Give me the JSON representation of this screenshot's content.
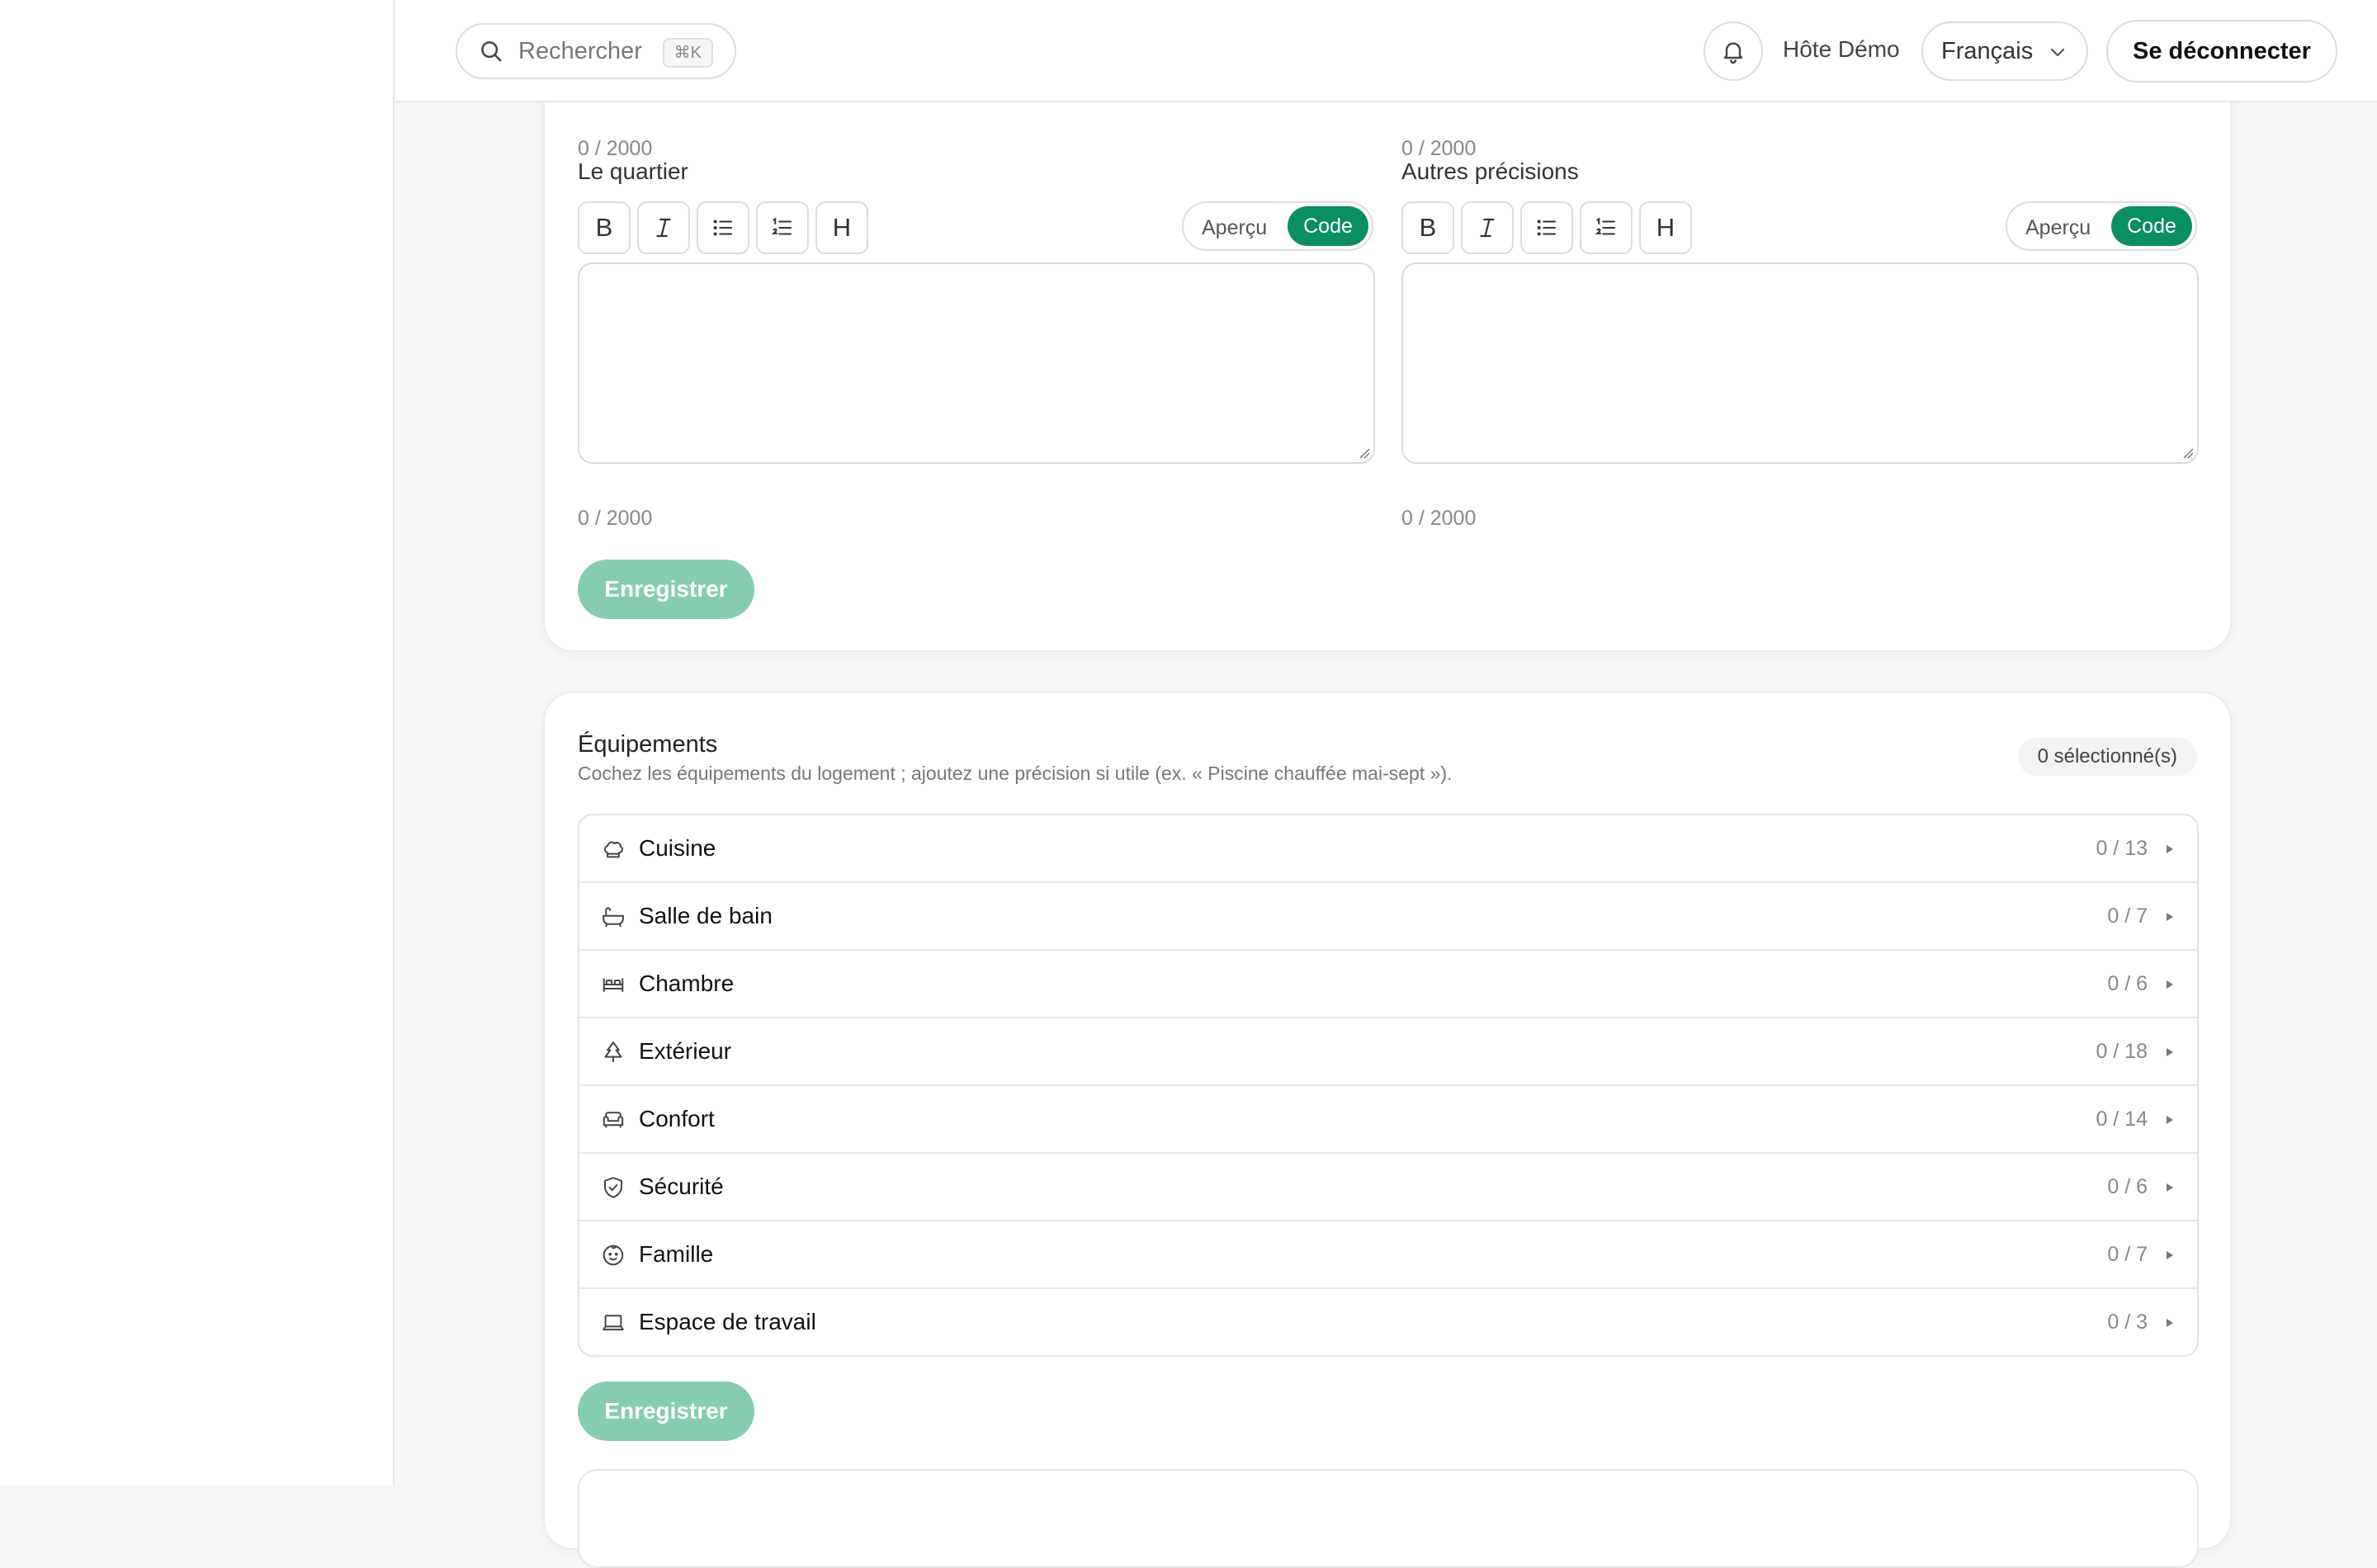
{
  "header": {
    "search_placeholder": "Rechercher",
    "search_shortcut": "⌘K",
    "user_name": "Hôte Démo",
    "language": "Français",
    "logout_label": "Se déconnecter"
  },
  "description_card": {
    "top_counters": [
      "0 / 2000",
      "0 / 2000"
    ],
    "fields": [
      {
        "label": "Le quartier",
        "counter": "0 / 2000",
        "preview_label": "Aperçu",
        "code_label": "Code"
      },
      {
        "label": "Autres précisions",
        "counter": "0 / 2000",
        "preview_label": "Aperçu",
        "code_label": "Code"
      }
    ],
    "toolbar": {
      "bold": "B",
      "italic": "I",
      "heading": "H"
    },
    "save_label": "Enregistrer"
  },
  "equipments": {
    "title": "Équipements",
    "description": "Cochez les équipements du logement ; ajoutez une précision si utile (ex. « Piscine chauffée mai-sept »).",
    "selected_badge": "0 sélectionné(s)",
    "categories": [
      {
        "label": "Cuisine",
        "count": "0 / 13",
        "icon": "chef-hat-icon"
      },
      {
        "label": "Salle de bain",
        "count": "0 / 7",
        "icon": "bathtub-icon"
      },
      {
        "label": "Chambre",
        "count": "0 / 6",
        "icon": "bed-icon"
      },
      {
        "label": "Extérieur",
        "count": "0 / 18",
        "icon": "tree-icon"
      },
      {
        "label": "Confort",
        "count": "0 / 14",
        "icon": "sofa-icon"
      },
      {
        "label": "Sécurité",
        "count": "0 / 6",
        "icon": "shield-check-icon"
      },
      {
        "label": "Famille",
        "count": "0 / 7",
        "icon": "baby-face-icon"
      },
      {
        "label": "Espace de travail",
        "count": "0 / 3",
        "icon": "laptop-icon"
      }
    ],
    "save_label": "Enregistrer"
  },
  "colors": {
    "accent": "#0a8f60",
    "save_disabled": "#86ccb1"
  }
}
